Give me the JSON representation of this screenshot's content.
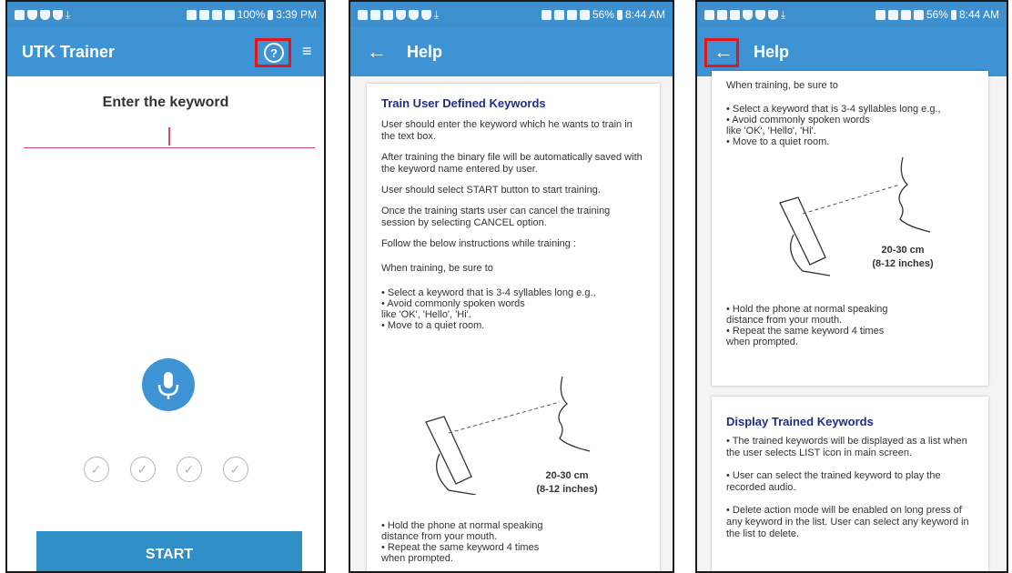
{
  "screen1": {
    "status": {
      "left_time": "100%",
      "time": "3:39 PM"
    },
    "app_title": "UTK Trainer",
    "keyword_heading": "Enter the keyword",
    "start_label": "START",
    "check_icons": [
      "check-1",
      "check-2",
      "check-3",
      "check-4"
    ]
  },
  "screen2": {
    "status": {
      "battery": "56%",
      "time": "8:44 AM"
    },
    "title": "Help",
    "card_title": "Train User Defined Keywords",
    "paragraphs": [
      "User should enter the keyword which he wants to train in the text box.",
      "After training the binary file will be automatically saved with the keyword name entered by user.",
      "User should select START button to start training.",
      "Once the training starts user can cancel the training session by selecting CANCEL option.",
      "Follow the below instructions while training :",
      "When training, be sure to"
    ],
    "bullets": [
      "• Select a keyword that is 3-4 syllables long e.g.,",
      "• Avoid commonly spoken words",
      "like 'OK', 'Hello', 'Hi'.",
      "• Move to a quiet room."
    ],
    "distance": "20-30 cm",
    "distance_in": "(8-12 inches)",
    "bottom_lines": [
      "• Hold the phone at normal speaking",
      "distance from your mouth.",
      "• Repeat the same keyword 4 times",
      "when prompted."
    ]
  },
  "screen3": {
    "status": {
      "battery": "56%",
      "time": "8:44 AM"
    },
    "title": "Help",
    "top_text": "When training, be sure to",
    "bullets": [
      "• Select a keyword that is 3-4 syllables long e.g.,",
      "• Avoid commonly spoken words",
      "like 'OK', 'Hello', 'Hi'.",
      "• Move to a quiet room."
    ],
    "distance": "20-30 cm",
    "distance_in": "(8-12 inches)",
    "bottom_lines": [
      "• Hold the phone at normal speaking",
      "distance from your mouth.",
      "• Repeat the same keyword 4 times",
      "when prompted."
    ],
    "card2_title": "Display Trained Keywords",
    "card2_paras": [
      "• The trained keywords will be displayed as a list when the user selects LIST icon in main screen.",
      "• User can select the trained keyword to play the recorded audio.",
      "• Delete action mode will be enabled on long press of any keyword in the list. User can select any keyword in the list to delete."
    ]
  },
  "colors": {
    "appbar": "#3e93d5",
    "highlight": "#e3161b",
    "accent_line": "#e0437a",
    "card_title": "#1d2d8b"
  }
}
